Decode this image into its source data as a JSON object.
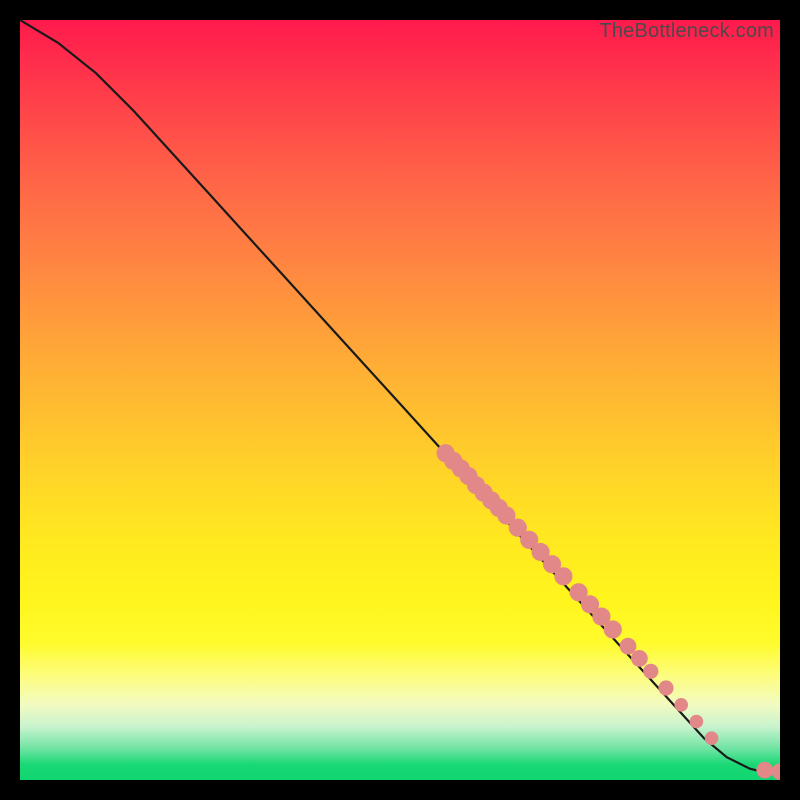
{
  "watermark": "TheBottleneck.com",
  "chart_data": {
    "type": "line",
    "title": "",
    "xlabel": "",
    "ylabel": "",
    "xlim": [
      0,
      100
    ],
    "ylim": [
      0,
      100
    ],
    "series": [
      {
        "name": "bottleneck-curve",
        "x": [
          0,
          5,
          10,
          15,
          20,
          25,
          30,
          35,
          40,
          45,
          50,
          55,
          60,
          65,
          70,
          75,
          80,
          85,
          90,
          93,
          96,
          98,
          100
        ],
        "y": [
          100,
          97,
          93,
          88,
          82.5,
          77,
          71.5,
          66,
          60.5,
          55,
          49.5,
          44,
          38.5,
          33,
          27.5,
          22,
          16.5,
          11,
          5.5,
          3,
          1.5,
          1,
          1
        ]
      }
    ],
    "markers": {
      "name": "highlighted-points",
      "color": "#e38888",
      "points": [
        {
          "x": 56,
          "y": 43,
          "r": 1.2
        },
        {
          "x": 57,
          "y": 42,
          "r": 1.2
        },
        {
          "x": 58,
          "y": 41,
          "r": 1.2
        },
        {
          "x": 59,
          "y": 40,
          "r": 1.2
        },
        {
          "x": 60,
          "y": 38.8,
          "r": 1.2
        },
        {
          "x": 61,
          "y": 37.8,
          "r": 1.2
        },
        {
          "x": 62,
          "y": 36.8,
          "r": 1.2
        },
        {
          "x": 63,
          "y": 35.8,
          "r": 1.2
        },
        {
          "x": 64,
          "y": 34.8,
          "r": 1.2
        },
        {
          "x": 65.5,
          "y": 33.2,
          "r": 1.2
        },
        {
          "x": 67,
          "y": 31.6,
          "r": 1.2
        },
        {
          "x": 68.5,
          "y": 30,
          "r": 1.2
        },
        {
          "x": 70,
          "y": 28.4,
          "r": 1.2
        },
        {
          "x": 71.5,
          "y": 26.8,
          "r": 1.2
        },
        {
          "x": 73.5,
          "y": 24.7,
          "r": 1.2
        },
        {
          "x": 75,
          "y": 23.1,
          "r": 1.2
        },
        {
          "x": 76.5,
          "y": 21.5,
          "r": 1.2
        },
        {
          "x": 78,
          "y": 19.8,
          "r": 1.2
        },
        {
          "x": 80,
          "y": 17.6,
          "r": 1.1
        },
        {
          "x": 81.5,
          "y": 16,
          "r": 1.1
        },
        {
          "x": 83,
          "y": 14.3,
          "r": 1.0
        },
        {
          "x": 85,
          "y": 12.1,
          "r": 1.0
        },
        {
          "x": 87,
          "y": 9.9,
          "r": 0.9
        },
        {
          "x": 89,
          "y": 7.7,
          "r": 0.9
        },
        {
          "x": 91,
          "y": 5.5,
          "r": 0.9
        },
        {
          "x": 98,
          "y": 1.3,
          "r": 1.1
        },
        {
          "x": 100,
          "y": 1.1,
          "r": 1.1
        }
      ]
    }
  }
}
